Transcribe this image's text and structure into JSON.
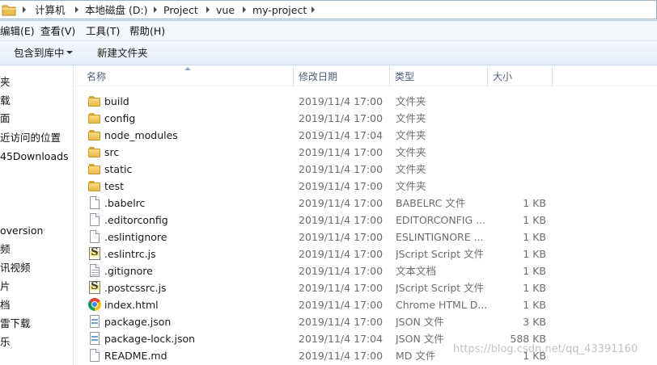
{
  "address_bar": {
    "crumbs": [
      "计算机",
      "本地磁盘 (D:)",
      "Project",
      "vue",
      "my-project"
    ]
  },
  "menu_bar": {
    "items": [
      "编辑(E)",
      "查看(V)",
      "工具(T)",
      "帮助(H)"
    ]
  },
  "toolbar": {
    "include_in_library": "包含到库中",
    "new_folder": "新建文件夹"
  },
  "nav_pane": {
    "items": [
      "夹",
      "载",
      "面",
      "近访问的位置",
      "45Downloads",
      "oversion",
      "频",
      "讯视频",
      "片",
      "档",
      "雷下载",
      "乐"
    ]
  },
  "columns": {
    "name": "名称",
    "date": "修改日期",
    "type": "类型",
    "size": "大小"
  },
  "files": [
    {
      "name": "build",
      "date": "2019/11/4 17:00",
      "type": "文件夹",
      "size": "",
      "icon": "folder-icon"
    },
    {
      "name": "config",
      "date": "2019/11/4 17:00",
      "type": "文件夹",
      "size": "",
      "icon": "folder-icon"
    },
    {
      "name": "node_modules",
      "date": "2019/11/4 17:04",
      "type": "文件夹",
      "size": "",
      "icon": "folder-icon"
    },
    {
      "name": "src",
      "date": "2019/11/4 17:00",
      "type": "文件夹",
      "size": "",
      "icon": "folder-icon"
    },
    {
      "name": "static",
      "date": "2019/11/4 17:00",
      "type": "文件夹",
      "size": "",
      "icon": "folder-icon"
    },
    {
      "name": "test",
      "date": "2019/11/4 17:00",
      "type": "文件夹",
      "size": "",
      "icon": "folder-icon"
    },
    {
      "name": ".babelrc",
      "date": "2019/11/4 17:00",
      "type": "BABELRC 文件",
      "size": "1 KB",
      "icon": "file-icon"
    },
    {
      "name": ".editorconfig",
      "date": "2019/11/4 17:00",
      "type": "EDITORCONFIG ...",
      "size": "1 KB",
      "icon": "file-icon"
    },
    {
      "name": ".eslintignore",
      "date": "2019/11/4 17:00",
      "type": "ESLINTIGNORE ...",
      "size": "1 KB",
      "icon": "file-icon"
    },
    {
      "name": ".eslintrc.js",
      "date": "2019/11/4 17:00",
      "type": "JScript Script 文件",
      "size": "1 KB",
      "icon": "jscript-icon"
    },
    {
      "name": ".gitignore",
      "date": "2019/11/4 17:00",
      "type": "文本文档",
      "size": "1 KB",
      "icon": "text-file-icon"
    },
    {
      "name": ".postcssrc.js",
      "date": "2019/11/4 17:00",
      "type": "JScript Script 文件",
      "size": "1 KB",
      "icon": "jscript-icon"
    },
    {
      "name": "index.html",
      "date": "2019/11/4 17:00",
      "type": "Chrome HTML D...",
      "size": "1 KB",
      "icon": "chrome-icon"
    },
    {
      "name": "package.json",
      "date": "2019/11/4 17:00",
      "type": "JSON 文件",
      "size": "3 KB",
      "icon": "json-file-icon"
    },
    {
      "name": "package-lock.json",
      "date": "2019/11/4 17:04",
      "type": "JSON 文件",
      "size": "588 KB",
      "icon": "json-file-icon"
    },
    {
      "name": "README.md",
      "date": "2019/11/4 17:00",
      "type": "MD 文件",
      "size": "1 KB",
      "icon": "file-icon"
    }
  ],
  "watermark": "https://blog.csdn.net/qq_43391160"
}
